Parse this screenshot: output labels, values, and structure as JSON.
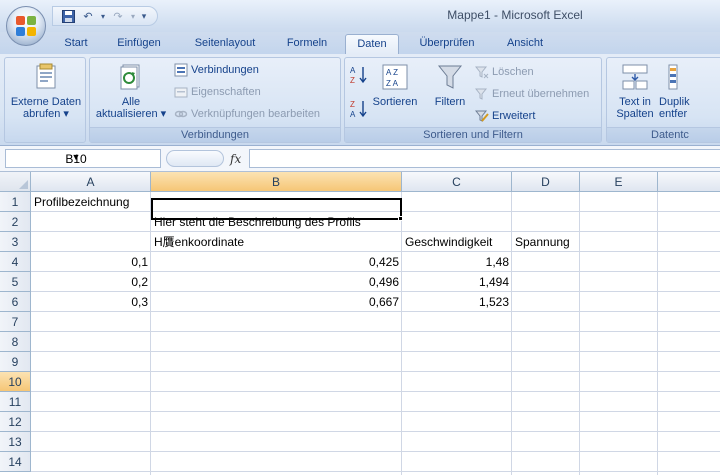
{
  "window": {
    "title": "Mappe1 - Microsoft Excel"
  },
  "tabs": [
    {
      "label": "Start"
    },
    {
      "label": "Einfügen"
    },
    {
      "label": "Seitenlayout"
    },
    {
      "label": "Formeln"
    },
    {
      "label": "Daten",
      "active": true
    },
    {
      "label": "Überprüfen"
    },
    {
      "label": "Ansicht"
    }
  ],
  "ribbon": {
    "external": {
      "label_line1": "Externe Daten",
      "label_line2": "abrufen ▾"
    },
    "connections": {
      "refresh_line1": "Alle",
      "refresh_line2": "aktualisieren ▾",
      "connections_label": "Verbindungen",
      "properties_label": "Eigenschaften",
      "edit_links_label": "Verknüpfungen bearbeiten",
      "group_label": "Verbindungen"
    },
    "sort_filter": {
      "sort_label": "Sortieren",
      "filter_label": "Filtern",
      "clear_label": "Löschen",
      "reapply_label": "Erneut übernehmen",
      "advanced_label": "Erweitert",
      "group_label": "Sortieren und Filtern"
    },
    "data_tools": {
      "text_to_columns_line1": "Text in",
      "text_to_columns_line2": "Spalten",
      "duplicates_line1": "Duplik",
      "duplicates_line2": "entfer",
      "group_label": "Datentc"
    }
  },
  "formula_bar": {
    "name_box": "B10",
    "fx": "fx",
    "formula": ""
  },
  "sheet": {
    "columns": [
      "A",
      "B",
      "C",
      "D",
      "E"
    ],
    "rows": [
      "1",
      "2",
      "3",
      "4",
      "5",
      "6",
      "7",
      "8",
      "9",
      "10",
      "11",
      "12",
      "13",
      "14"
    ],
    "cells": {
      "A1": "Profilbezeichnung",
      "B2": "Hier steht die Beschreibung des Profils",
      "B3": "H贋enkoordinate",
      "C3": "Geschwindigkeit",
      "D3": "Spannung",
      "A4": "0,1",
      "B4": "0,425",
      "C4": "1,48",
      "A5": "0,2",
      "B5": "0,496",
      "C5": "1,494",
      "A6": "0,3",
      "B6": "0,667",
      "C6": "1,523"
    }
  },
  "colors": {
    "accent": "#15428b",
    "selected_header": "#f6c676"
  }
}
